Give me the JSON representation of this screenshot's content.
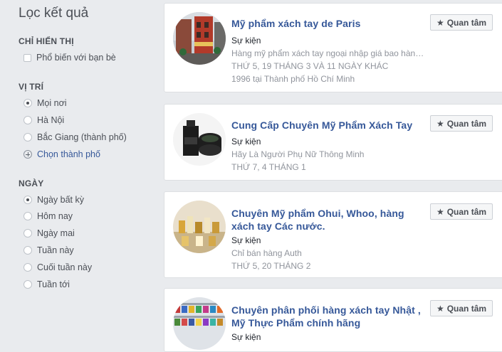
{
  "filters": {
    "title": "Lọc kết quả",
    "display": {
      "header": "CHỈ HIỂN THỊ",
      "options": [
        {
          "label": "Phổ biến với bạn bè",
          "checked": false
        }
      ]
    },
    "location": {
      "header": "VỊ TRÍ",
      "options": [
        {
          "label": "Mọi nơi",
          "selected": true
        },
        {
          "label": "Hà Nội",
          "selected": false
        },
        {
          "label": "Bắc Giang (thành phố)",
          "selected": false
        }
      ],
      "choose_city": "Chọn thành phố"
    },
    "date": {
      "header": "NGÀY",
      "options": [
        {
          "label": "Ngày bất kỳ",
          "selected": true
        },
        {
          "label": "Hôm nay",
          "selected": false
        },
        {
          "label": "Ngày mai",
          "selected": false
        },
        {
          "label": "Tuần này",
          "selected": false
        },
        {
          "label": "Cuối tuần này",
          "selected": false
        },
        {
          "label": "Tuần tới",
          "selected": false
        }
      ]
    }
  },
  "results": [
    {
      "title": "Mỹ phẩm xách tay de Paris",
      "category": "Sự kiện",
      "description": "Hàng mỹ phẩm xách tay ngoại nhập giá bao hàng cho chị em cô c...",
      "date": "THỨ 5, 19 THÁNG 3 VÀ 11 NGÀY KHÁC",
      "location": "1996 tại Thành phố Hồ Chí Minh",
      "button": "Quan tâm"
    },
    {
      "title": "Cung Cấp Chuyên Mỹ Phẩm Xách Tay",
      "category": "Sự kiện",
      "description": "Hãy Là Người Phụ Nữ Thông Minh",
      "date": "THỨ 7, 4 THÁNG 1",
      "button": "Quan tâm"
    },
    {
      "title": "Chuyên Mỹ phẩm Ohui, Whoo, hàng xách tay Các nước.",
      "category": "Sự kiện",
      "description": "Chỉ bán hàng Auth",
      "date": "THỨ 5, 20 THÁNG 2",
      "button": "Quan tâm"
    },
    {
      "title": "Chuyên phân phối hàng xách tay Nhật , Mỹ Thực Phẩm chính hãng",
      "category": "Sự kiện",
      "button": "Quan tâm"
    }
  ],
  "icons": {
    "star": "star-icon",
    "plus": "plus-circle-icon"
  }
}
